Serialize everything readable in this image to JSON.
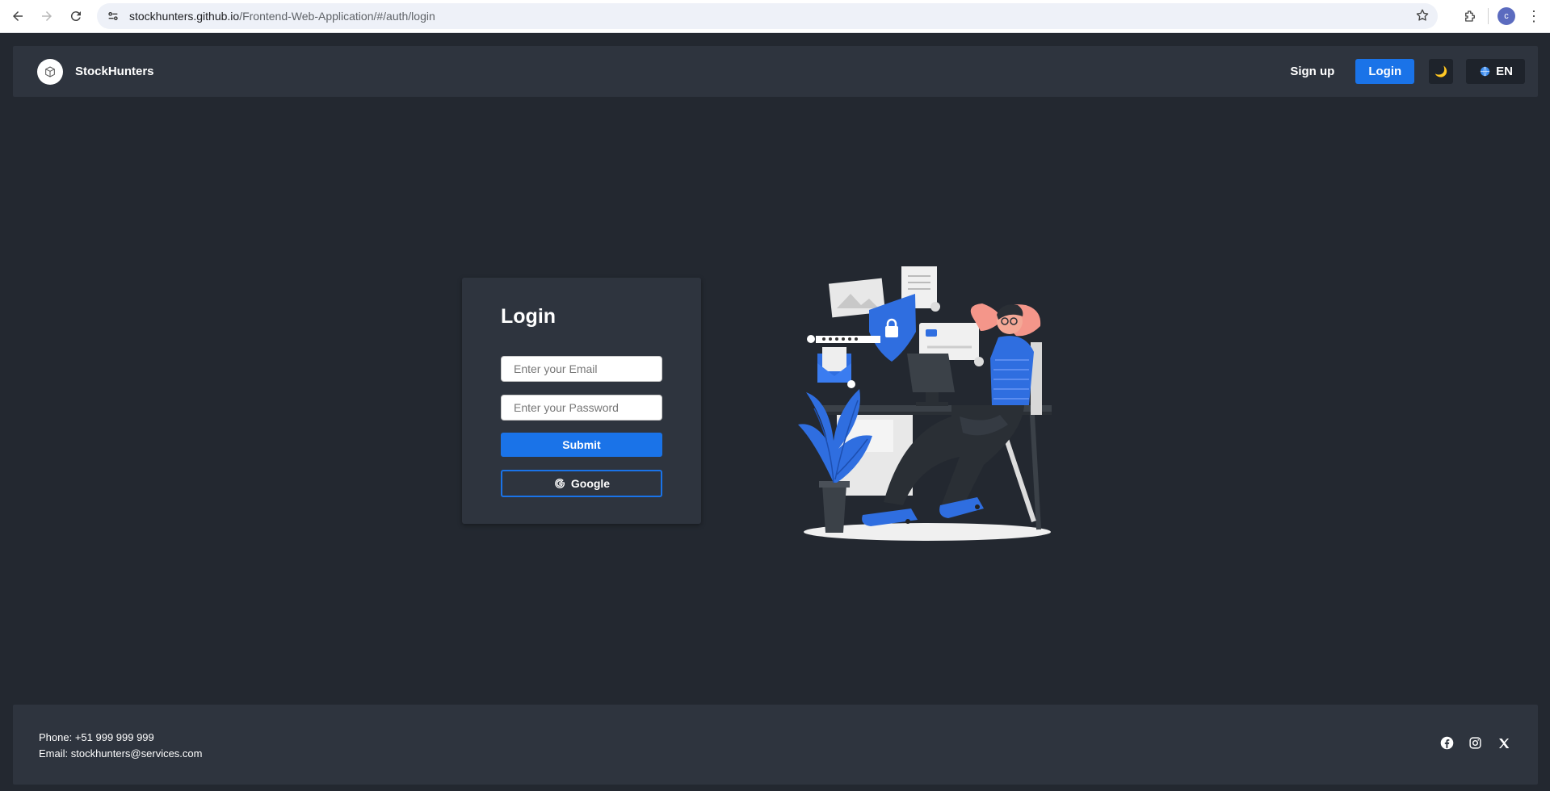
{
  "browser": {
    "url_host": "stockhunters.github.io",
    "url_path": "/Frontend-Web-Application/#/auth/login",
    "profile_initial": "c"
  },
  "header": {
    "brand": "StockHunters",
    "signup_label": "Sign up",
    "login_label": "Login",
    "theme_icon": "🌙",
    "language_label": "EN"
  },
  "login_card": {
    "title": "Login",
    "email_placeholder": "Enter your Email",
    "password_placeholder": "Enter your Password",
    "submit_label": "Submit",
    "google_label": "Google"
  },
  "footer": {
    "phone": "Phone: +51 999 999 999",
    "email": "Email: stockhunters@services.com",
    "socials": [
      "facebook-icon",
      "instagram-icon",
      "x-icon"
    ]
  },
  "colors": {
    "background": "#232830",
    "panel": "#2e343e",
    "accent": "#1a73e8"
  }
}
